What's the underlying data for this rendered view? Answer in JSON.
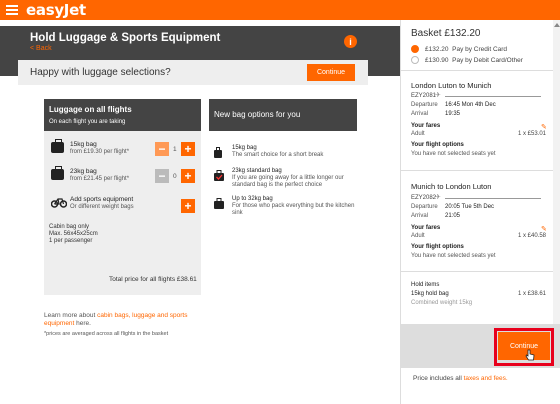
{
  "header": {
    "brand": "easyJet",
    "menu_icon": "hamburger-menu-icon"
  },
  "page": {
    "title": "Hold Luggage & Sports Equipment",
    "back_label": "< Back",
    "info_icon": "i",
    "happy_text": "Happy with luggage selections?",
    "continue_label": "Continue"
  },
  "luggage": {
    "heading": "Luggage on all flights",
    "subheading": "On each flight you are taking",
    "bags": [
      {
        "name": "15kg bag",
        "price": "from £19.30 per flight*",
        "quantity": "1",
        "minus": "−",
        "plus": "+"
      },
      {
        "name": "23kg bag",
        "price": "from £21.45 per flight*",
        "quantity": "0",
        "minus": "−",
        "plus": "+"
      }
    ],
    "sports": {
      "name": "Add sports equipment",
      "sub": "Or different weight bags",
      "plus": "+"
    },
    "cabin": {
      "line1": "Cabin bag only",
      "line2": "Max. 56x45x25cm",
      "line3": "1 per passenger"
    },
    "total": "Total price for all flights £38.61"
  },
  "new_bags": {
    "heading": "New bag options for you",
    "options": [
      {
        "name": "15kg bag",
        "desc": "The smart choice for a short break"
      },
      {
        "name": "23kg standard bag",
        "desc": "If you are going away for a little longer our standard bag is the perfect choice"
      },
      {
        "name": "Up to 32kg bag",
        "desc": "For those who pack everything but the kitchen sink"
      }
    ]
  },
  "footer_notes": {
    "learn_prefix": "Learn more about ",
    "learn_link": "cabin bags, luggage and sports equipment",
    "learn_suffix": " here.",
    "averaged": "*prices are averaged across all flights in the basket"
  },
  "basket": {
    "title": "Basket £132.20",
    "payments": [
      {
        "amount": "£132.20",
        "label": "Pay by Credit Card",
        "selected": true
      },
      {
        "amount": "£130.90",
        "label": "Pay by Debit Card/Other",
        "selected": false
      }
    ],
    "flights": [
      {
        "route": "London Luton to Munich",
        "number": "EZY2081",
        "departure_label": "Departure",
        "departure": "16:45 Mon 4th Dec",
        "arrival_label": "Arrival",
        "arrival": "19:35",
        "fares_label": "Your fares",
        "fare_type": "Adult",
        "fare_price": "1 x £53.01",
        "options_label": "Your flight options",
        "options_text": "You have not selected seats yet"
      },
      {
        "route": "Munich to London Luton",
        "number": "EZY2082",
        "departure_label": "Departure",
        "departure": "20:05 Tue 5th Dec",
        "arrival_label": "Arrival",
        "arrival": "21:05",
        "fares_label": "Your fares",
        "fare_type": "Adult",
        "fare_price": "1 x £40.58",
        "options_label": "Your flight options",
        "options_text": "You have not selected seats yet"
      }
    ],
    "hold": {
      "label": "Hold items",
      "item": "15kg hold bag",
      "price": "1 x £38.61",
      "weight": "Combined weight 15kg"
    },
    "continue_label": "Continue",
    "price_includes_prefix": "Price includes all ",
    "price_includes_link": "taxes and fees."
  },
  "colors": {
    "brand": "#ff6600",
    "dark": "#444444",
    "panel": "#eeeeee",
    "highlight": "#e8001c"
  }
}
